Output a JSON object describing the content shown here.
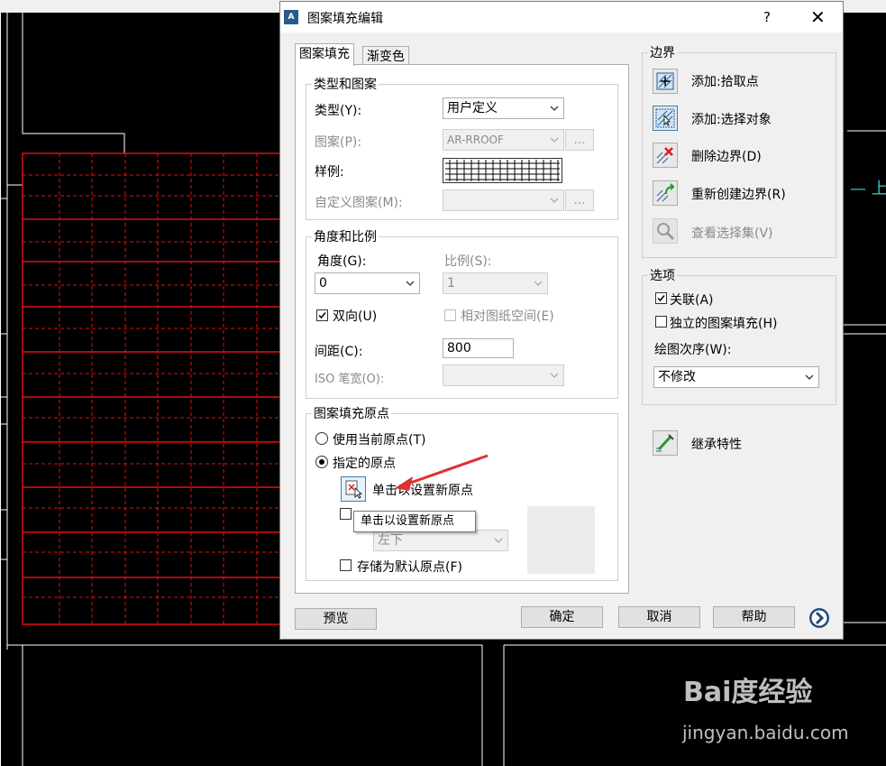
{
  "dialog": {
    "title": "图案填充编辑",
    "help_label": "?",
    "close_label": "✕",
    "app_icon_text": "A"
  },
  "tabs": [
    {
      "label": "图案填充",
      "active": true
    },
    {
      "label": "渐变色",
      "active": false
    }
  ],
  "type_pattern": {
    "legend": "类型和图案",
    "type_label": "类型(Y):",
    "type_value": "用户定义",
    "pattern_label": "图案(P):",
    "pattern_value": "AR-RROOF",
    "browse_label": "...",
    "swatch_label": "样例:",
    "custom_label": "自定义图案(M):",
    "custom_value": ""
  },
  "angle_scale": {
    "legend": "角度和比例",
    "angle_label": "角度(G):",
    "angle_value": "0",
    "scale_label": "比例(S):",
    "scale_value": "1",
    "double_label": "双向(U)",
    "double_checked": true,
    "relative_label": "相对图纸空间(E)",
    "relative_checked": false,
    "spacing_label": "间距(C):",
    "spacing_value": "800",
    "iso_label": "ISO 笔宽(O):",
    "iso_value": ""
  },
  "origin": {
    "legend": "图案填充原点",
    "use_current_label": "使用当前原点(T)",
    "specified_label": "指定的原点",
    "specified_selected": true,
    "click_set_label": "单击以设置新原点",
    "bottom_left_value": "左下",
    "store_default_label": "存储为默认原点(F)",
    "tooltip": "单击以设置新原点"
  },
  "boundary": {
    "legend": "边界",
    "items": [
      {
        "label": "添加:拾取点",
        "icon": "pick-points-icon",
        "enabled": true
      },
      {
        "label": "添加:选择对象",
        "icon": "select-objects-icon",
        "enabled": true
      },
      {
        "label": "删除边界(D)",
        "icon": "remove-boundaries-icon",
        "enabled": true
      },
      {
        "label": "重新创建边界(R)",
        "icon": "recreate-boundary-icon",
        "enabled": true
      },
      {
        "label": "查看选择集(V)",
        "icon": "magnifier-icon",
        "enabled": false
      }
    ]
  },
  "options": {
    "legend": "选项",
    "associative_label": "关联(A)",
    "associative_checked": true,
    "separate_label": "独立的图案填充(H)",
    "separate_checked": false,
    "draw_order_label": "绘图次序(W):",
    "draw_order_value": "不修改"
  },
  "inherit_label": "继承特性",
  "footer": {
    "preview_label": "预览",
    "ok_label": "确定",
    "cancel_label": "取消",
    "help_label": "帮助"
  },
  "watermark": {
    "brand": "Bai度经验",
    "url": "jingyan.baidu.com"
  },
  "colors": {
    "hatch_boundary": "#e01010",
    "hatch_lines": "#e01010",
    "cad_lines": "#ffffff",
    "cad_background": "#000000",
    "annotation_arrow": "#e03030",
    "cad_text_cyan": "#3fbfbf"
  }
}
